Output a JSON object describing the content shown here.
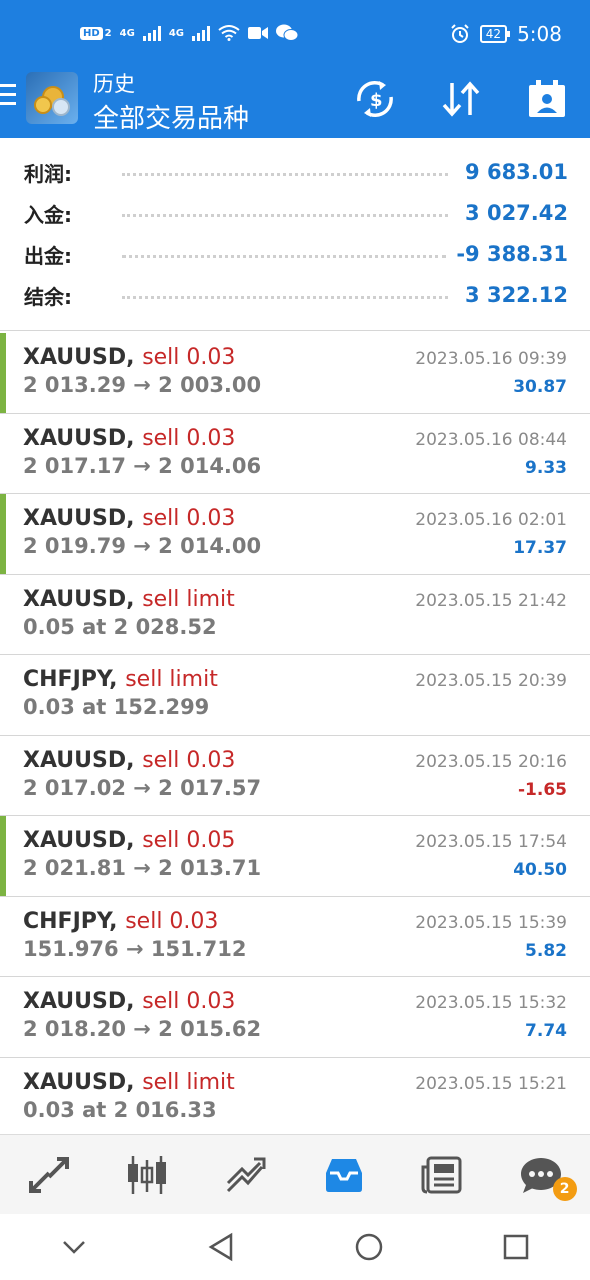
{
  "status_bar": {
    "network_label": "HD",
    "sim1_badge": "2",
    "net1": "4G",
    "net2": "4G",
    "battery": "42",
    "time": "5:08"
  },
  "header": {
    "title": "历史",
    "subtitle": "全部交易品种"
  },
  "summary": [
    {
      "label": "利润:",
      "value": "9 683.01"
    },
    {
      "label": "入金:",
      "value": "3 027.42"
    },
    {
      "label": "出金:",
      "value": "-9 388.31"
    },
    {
      "label": "结余:",
      "value": "3 322.12"
    }
  ],
  "trades": [
    {
      "symbol": "XAUUSD,",
      "action": "sell 0.03",
      "detail": "2 013.29 → 2 003.00",
      "time": "2023.05.16 09:39",
      "profit": "30.87",
      "marker": true,
      "negative": false
    },
    {
      "symbol": "XAUUSD,",
      "action": "sell 0.03",
      "detail": "2 017.17 → 2 014.06",
      "time": "2023.05.16 08:44",
      "profit": "9.33",
      "marker": false,
      "negative": false
    },
    {
      "symbol": "XAUUSD,",
      "action": "sell 0.03",
      "detail": "2 019.79 → 2 014.00",
      "time": "2023.05.16 02:01",
      "profit": "17.37",
      "marker": true,
      "negative": false
    },
    {
      "symbol": "XAUUSD,",
      "action": "sell limit",
      "detail": "0.05 at 2 028.52",
      "time": "2023.05.15 21:42",
      "profit": "",
      "marker": false,
      "negative": false
    },
    {
      "symbol": "CHFJPY,",
      "action": "sell limit",
      "detail": "0.03 at 152.299",
      "time": "2023.05.15 20:39",
      "profit": "",
      "marker": false,
      "negative": false
    },
    {
      "symbol": "XAUUSD,",
      "action": "sell 0.03",
      "detail": "2 017.02 → 2 017.57",
      "time": "2023.05.15 20:16",
      "profit": "-1.65",
      "marker": false,
      "negative": true
    },
    {
      "symbol": "XAUUSD,",
      "action": "sell 0.05",
      "detail": "2 021.81 → 2 013.71",
      "time": "2023.05.15 17:54",
      "profit": "40.50",
      "marker": true,
      "negative": false
    },
    {
      "symbol": "CHFJPY,",
      "action": "sell 0.03",
      "detail": "151.976 → 151.712",
      "time": "2023.05.15 15:39",
      "profit": "5.82",
      "marker": false,
      "negative": false
    },
    {
      "symbol": "XAUUSD,",
      "action": "sell 0.03",
      "detail": "2 018.20 → 2 015.62",
      "time": "2023.05.15 15:32",
      "profit": "7.74",
      "marker": false,
      "negative": false
    },
    {
      "symbol": "XAUUSD,",
      "action": "sell limit",
      "detail": "0.03 at 2 016.33",
      "time": "2023.05.15 15:21",
      "profit": "",
      "marker": false,
      "negative": false
    }
  ],
  "bottom_nav": {
    "items": [
      "quotes-icon",
      "chart-icon",
      "trade-icon",
      "history-icon",
      "news-icon",
      "chat-icon"
    ],
    "active_index": 3,
    "chat_badge": "2"
  },
  "colors": {
    "header_blue": "#1e7fe0",
    "value_blue": "#1a73c8",
    "sell_red": "#c62828",
    "marker_green": "#7cb342"
  }
}
